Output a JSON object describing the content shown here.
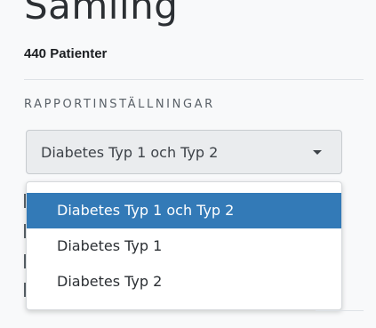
{
  "header": {
    "title": "Samling",
    "patient_count": "440 Patienter"
  },
  "settings": {
    "heading": "RAPPORTINSTÄLLNINGAR",
    "diabetes_select": {
      "selected_value": "Diabetes Typ 1 och Typ 2",
      "options": [
        "Diabetes Typ 1 och Typ 2",
        "Diabetes Typ 1",
        "Diabetes Typ 2"
      ],
      "open": true
    }
  },
  "colors": {
    "selected_option_bg": "#337ab7",
    "panel_bg": "#f8f9fa"
  },
  "icons": {
    "select_caret": "caret-down-icon"
  }
}
